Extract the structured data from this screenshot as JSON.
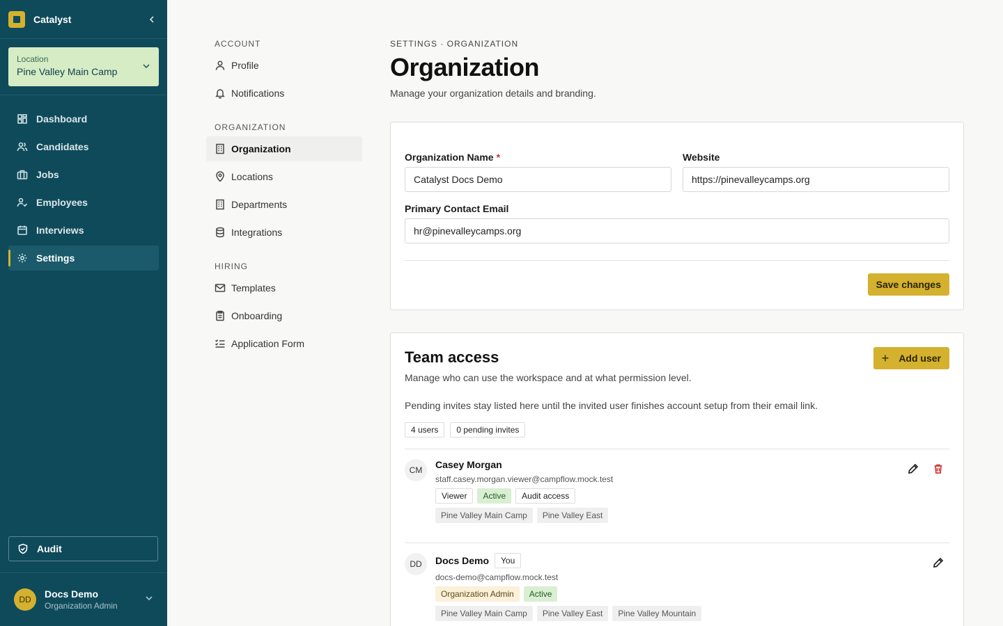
{
  "brand": {
    "name": "Catalyst"
  },
  "location": {
    "label": "Location",
    "value": "Pine Valley Main Camp"
  },
  "nav": [
    {
      "label": "Dashboard",
      "icon": "dashboard-icon"
    },
    {
      "label": "Candidates",
      "icon": "users-icon"
    },
    {
      "label": "Jobs",
      "icon": "briefcase-icon"
    },
    {
      "label": "Employees",
      "icon": "user-check-icon"
    },
    {
      "label": "Interviews",
      "icon": "calendar-icon"
    },
    {
      "label": "Settings",
      "icon": "gear-icon",
      "active": true
    }
  ],
  "audit": {
    "label": "Audit"
  },
  "user": {
    "initials": "DD",
    "name": "Docs Demo",
    "role": "Organization Admin"
  },
  "settings_nav": {
    "account_heading": "ACCOUNT",
    "account": [
      "Profile",
      "Notifications"
    ],
    "organization_heading": "ORGANIZATION",
    "organization": [
      "Organization",
      "Locations",
      "Departments",
      "Integrations"
    ],
    "hiring_heading": "HIRING",
    "hiring": [
      "Templates",
      "Onboarding",
      "Application Form"
    ]
  },
  "page": {
    "breadcrumb": "SETTINGS · ORGANIZATION",
    "title": "Organization",
    "description": "Manage your organization details and branding."
  },
  "org_form": {
    "name_label": "Organization Name",
    "required_mark": "*",
    "name_value": "Catalyst Docs Demo",
    "website_label": "Website",
    "website_value": "https://pinevalleycamps.org",
    "email_label": "Primary Contact Email",
    "email_value": "hr@pinevalleycamps.org",
    "save_label": "Save changes"
  },
  "team": {
    "title": "Team access",
    "description": "Manage who can use the workspace and at what permission level.",
    "note": "Pending invites stay listed here until the invited user finishes account setup from their email link.",
    "add_label": "Add user",
    "users_count": "4 users",
    "pending_count": "0 pending invites",
    "members": [
      {
        "initials": "CM",
        "name": "Casey Morgan",
        "email": "staff.casey.morgan.viewer@campflow.mock.test",
        "role": "Viewer",
        "status": "Active",
        "extra": "Audit access",
        "locations": [
          "Pine Valley Main Camp",
          "Pine Valley East"
        ]
      },
      {
        "initials": "DD",
        "name": "Docs Demo",
        "you": "You",
        "email": "docs-demo@campflow.mock.test",
        "role": "Organization Admin",
        "status": "Active",
        "locations": [
          "Pine Valley Main Camp",
          "Pine Valley East",
          "Pine Valley Mountain"
        ]
      }
    ]
  },
  "colors": {
    "sidebar": "#0f4a5b",
    "accent": "#d4b12f",
    "location_bg": "#d6ecc5"
  }
}
